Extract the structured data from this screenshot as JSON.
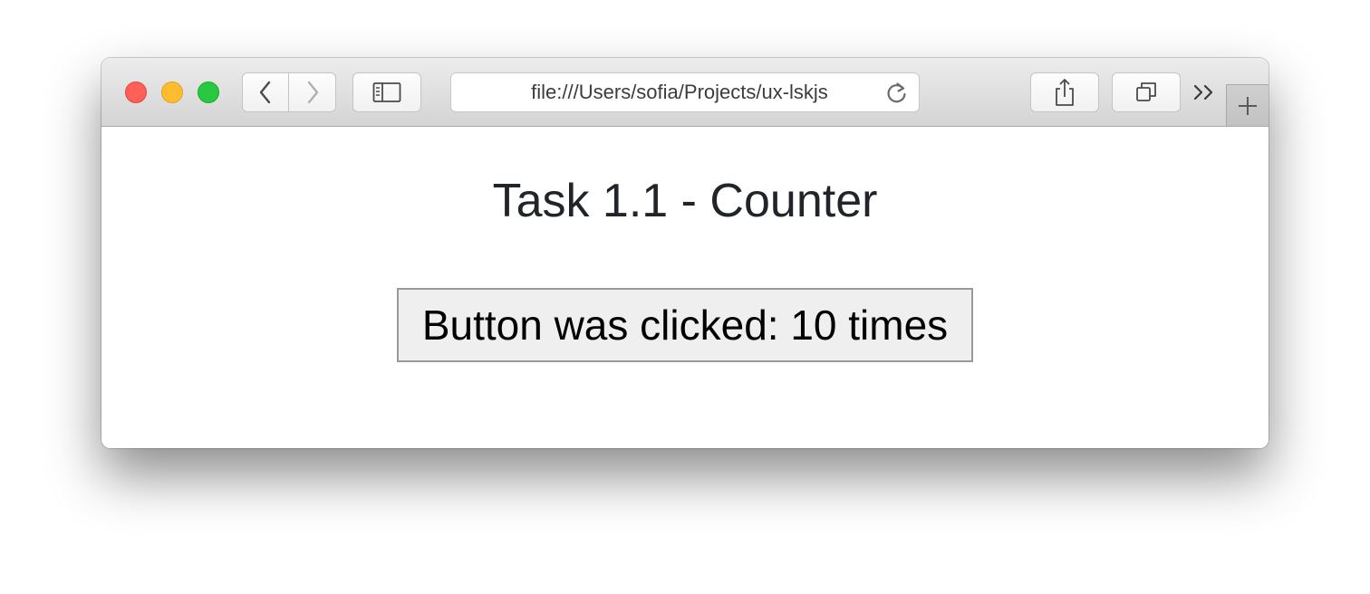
{
  "browser": {
    "address_bar": {
      "url": "file:///Users/sofia/Projects/ux-lskjs"
    },
    "icons": {
      "back": "chevron-left-icon",
      "forward": "chevron-right-icon",
      "sidebar": "sidebar-icon",
      "reload": "reload-icon",
      "share": "share-icon",
      "tabs": "tabs-overview-icon",
      "overflow": "double-chevron-icon",
      "new_tab": "plus-icon"
    },
    "traffic_lights": {
      "close": "#fe5f57",
      "minimize": "#febc2e",
      "zoom": "#28c840"
    }
  },
  "page": {
    "title": "Task 1.1 - Counter",
    "counter_button_label": "Button was clicked: 10 times"
  }
}
